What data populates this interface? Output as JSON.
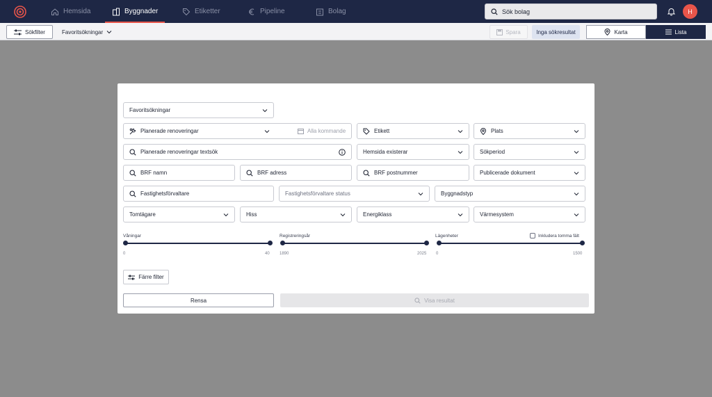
{
  "nav": {
    "items": [
      {
        "label": "Hemsida",
        "icon": "home-icon"
      },
      {
        "label": "Byggnader",
        "icon": "building-icon",
        "active": true
      },
      {
        "label": "Etiketter",
        "icon": "tag-icon"
      },
      {
        "label": "Pipeline",
        "icon": "euro-icon"
      },
      {
        "label": "Bolag",
        "icon": "company-icon"
      }
    ],
    "search_placeholder": "Sök bolag",
    "avatar_initial": "H"
  },
  "toolbar": {
    "sokfilter_label": "Sökfilter",
    "favorites_label": "Favoritsökningar",
    "spara_label": "Spara",
    "no_results_label": "Inga sökresultat",
    "karta_label": "Karta",
    "lista_label": "Lista"
  },
  "modal": {
    "favorites_select": "Favoritsökningar",
    "planerade_renoveringar": "Planerade renoveringar",
    "alla_kommande": "Alla kommande",
    "etikett": "Etikett",
    "plats": "Plats",
    "renovering_textsok": "Planerade renoveringar textsök",
    "hemsida_existerar": "Hemsida existerar",
    "sokperiod": "Sökperiod",
    "brf_namn": "BRF namn",
    "brf_adress": "BRF adress",
    "brf_postnummer": "BRF postnummer",
    "publicerade_dokument": "Publicerade dokument",
    "fastighetsforvaltare": "Fastighetsförvaltare",
    "fastighetsforvaltare_status": "Fastighetsförvaltare status",
    "byggnadstyp": "Byggnadstyp",
    "tomtagare": "Tomtägare",
    "hiss": "Hiss",
    "energiklass": "Energiklass",
    "varmesystem": "Värmesystem",
    "sliders": [
      {
        "label": "Våningar",
        "min": "0",
        "max": "40"
      },
      {
        "label": "Registreringsår",
        "min": "1890",
        "max": "2025"
      },
      {
        "label": "Lägenheter",
        "min": "0",
        "max": "1500"
      }
    ],
    "include_empty_label": "Inkludera tomma fält",
    "farre_filter_label": "Färre filter",
    "rensa_label": "Rensa",
    "visa_resultat_label": "Visa resultat"
  },
  "colors": {
    "nav_bg": "#1e2745",
    "accent": "#e8554a",
    "overlay": "#8c8c8c"
  }
}
